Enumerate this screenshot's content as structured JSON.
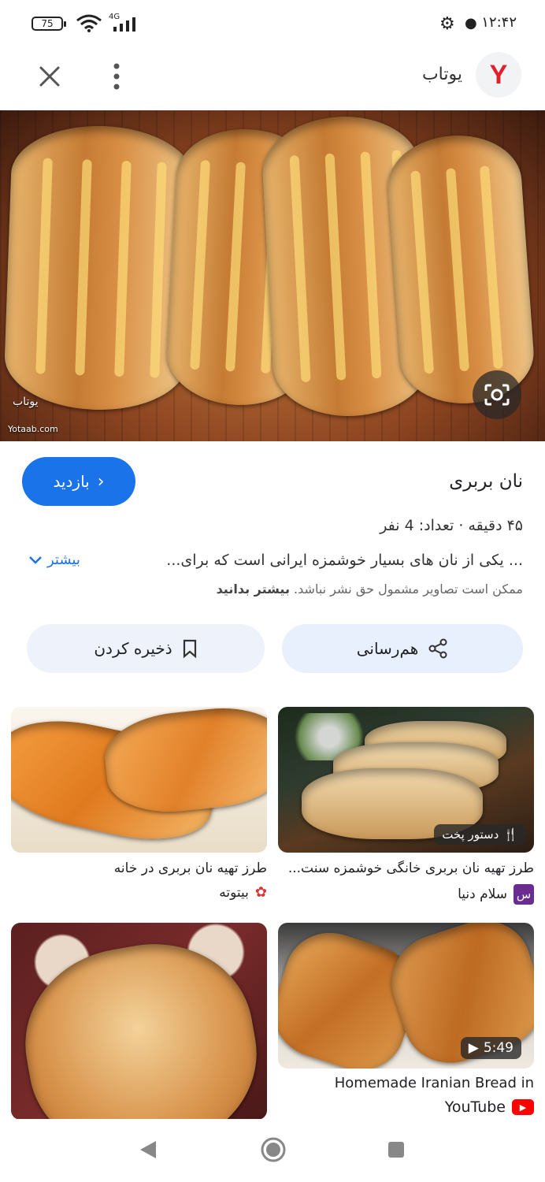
{
  "status_bar": {
    "battery": "75",
    "network": "4G",
    "time": "۱۲:۴۲"
  },
  "header": {
    "site_name": "یوتاب",
    "logo_letter": "Y"
  },
  "hero": {
    "watermark": "یوتاب",
    "watermark_url": "Yotaab.com"
  },
  "recipe": {
    "title": "نان بربری",
    "meta": "۴۵ دقیقه · تعداد: 4 نفر",
    "description": "... یکی از نان های بسیار خوشمزه ایرانی است که برای...",
    "more_label": "بیشتر",
    "copyright_text": "ممکن است تصاویر مشمول حق نشر نباشد.",
    "copyright_link": "بیشتر بدانید",
    "visit_label": "بازدید"
  },
  "actions": {
    "share_label": "هم‌رسانی",
    "save_label": "ذخیره کردن"
  },
  "cards": [
    {
      "title": "طرز تهیه نان بربری خانگی خوشمزه سنت...",
      "source": "سلام دنیا",
      "badge": "دستور پخت",
      "source_icon": "س"
    },
    {
      "title": "طرز تهیه نان بربری در خانه",
      "source": "بیتوته"
    },
    {
      "title": "Homemade Iranian Bread in",
      "source": "YouTube",
      "duration": "5:49"
    },
    {
      "title": "",
      "source": ""
    }
  ],
  "colors": {
    "accent": "#1a73e8",
    "pill": "#e8f0fe",
    "logo_red": "#e0202b",
    "youtube_red": "#ff0000"
  }
}
